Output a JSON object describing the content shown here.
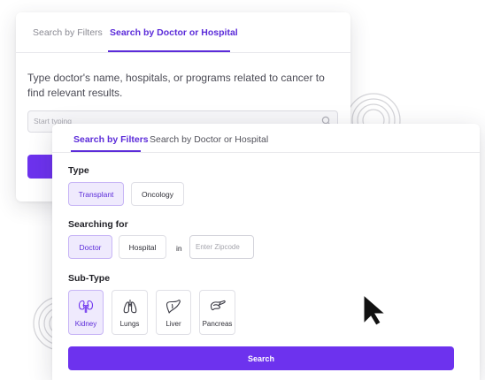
{
  "back_panel": {
    "tabs": [
      "Search by Filters",
      "Search by Doctor or Hospital"
    ],
    "active_tab": "Search by Doctor or Hospital",
    "description": "Type doctor's name, hospitals, or programs related to cancer to find relevant results.",
    "search_placeholder": "Start typing",
    "search_icon": "search-icon"
  },
  "front_panel": {
    "tabs": [
      "Search by Filters",
      "Search by Doctor or Hospital"
    ],
    "active_tab": "Search by Filters",
    "type": {
      "label": "Type",
      "options": [
        "Transplant",
        "Oncology"
      ],
      "selected": "Transplant"
    },
    "searching_for": {
      "label": "Searching for",
      "options": [
        "Doctor",
        "Hospital"
      ],
      "selected": "Doctor",
      "connector": "in",
      "zip_placeholder": "Enter Zipcode"
    },
    "sub_type": {
      "label": "Sub-Type",
      "options": [
        {
          "label": "Kidney",
          "icon": "kidney-icon"
        },
        {
          "label": "Lungs",
          "icon": "lungs-icon"
        },
        {
          "label": "Liver",
          "icon": "liver-icon"
        },
        {
          "label": "Pancreas",
          "icon": "pancreas-icon"
        }
      ],
      "selected": "Kidney"
    },
    "search_button": "Search"
  },
  "colors": {
    "accent": "#6d32ee",
    "accent_light": "#efeafd",
    "text_dark": "#1f1f25"
  }
}
